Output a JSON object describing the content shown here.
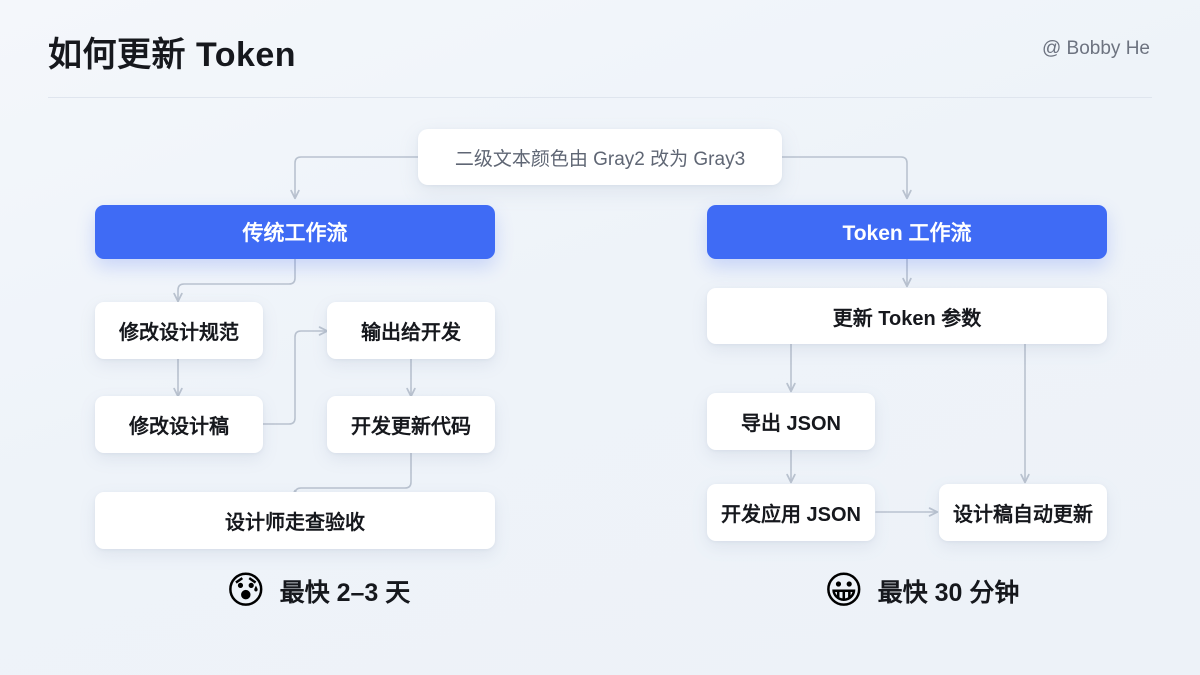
{
  "header": {
    "title": "如何更新 Token",
    "author": "@ Bobby He"
  },
  "colors": {
    "background": "#f2f6fb",
    "accent_blue": "#3f6bf5",
    "node_bg": "#ffffff",
    "text_primary": "#16181d",
    "text_secondary": "#5f6674",
    "connector": "#b9c2cf"
  },
  "trigger": {
    "label": "二级文本颜色由 Gray2 改为 Gray3"
  },
  "columns": [
    {
      "id": "traditional",
      "header": "传统工作流",
      "nodes": [
        {
          "id": "t1",
          "label": "修改设计规范"
        },
        {
          "id": "t2",
          "label": "修改设计稿"
        },
        {
          "id": "t3",
          "label": "输出给开发"
        },
        {
          "id": "t4",
          "label": "开发更新代码"
        },
        {
          "id": "t5",
          "label": "设计师走查验收"
        }
      ],
      "summary": {
        "emoji": "😰",
        "emoji_name": "anxious-face-with-sweat-emoji",
        "text": "最快 2–3 天"
      }
    },
    {
      "id": "token",
      "header": "Token 工作流",
      "nodes": [
        {
          "id": "k1",
          "label": "更新 Token 参数"
        },
        {
          "id": "k2",
          "label": "导出 JSON"
        },
        {
          "id": "k3",
          "label": "开发应用 JSON"
        },
        {
          "id": "k4",
          "label": "设计稿自动更新"
        }
      ],
      "summary": {
        "emoji": "😀",
        "emoji_name": "grinning-face-emoji",
        "text": "最快 30 分钟"
      }
    }
  ]
}
